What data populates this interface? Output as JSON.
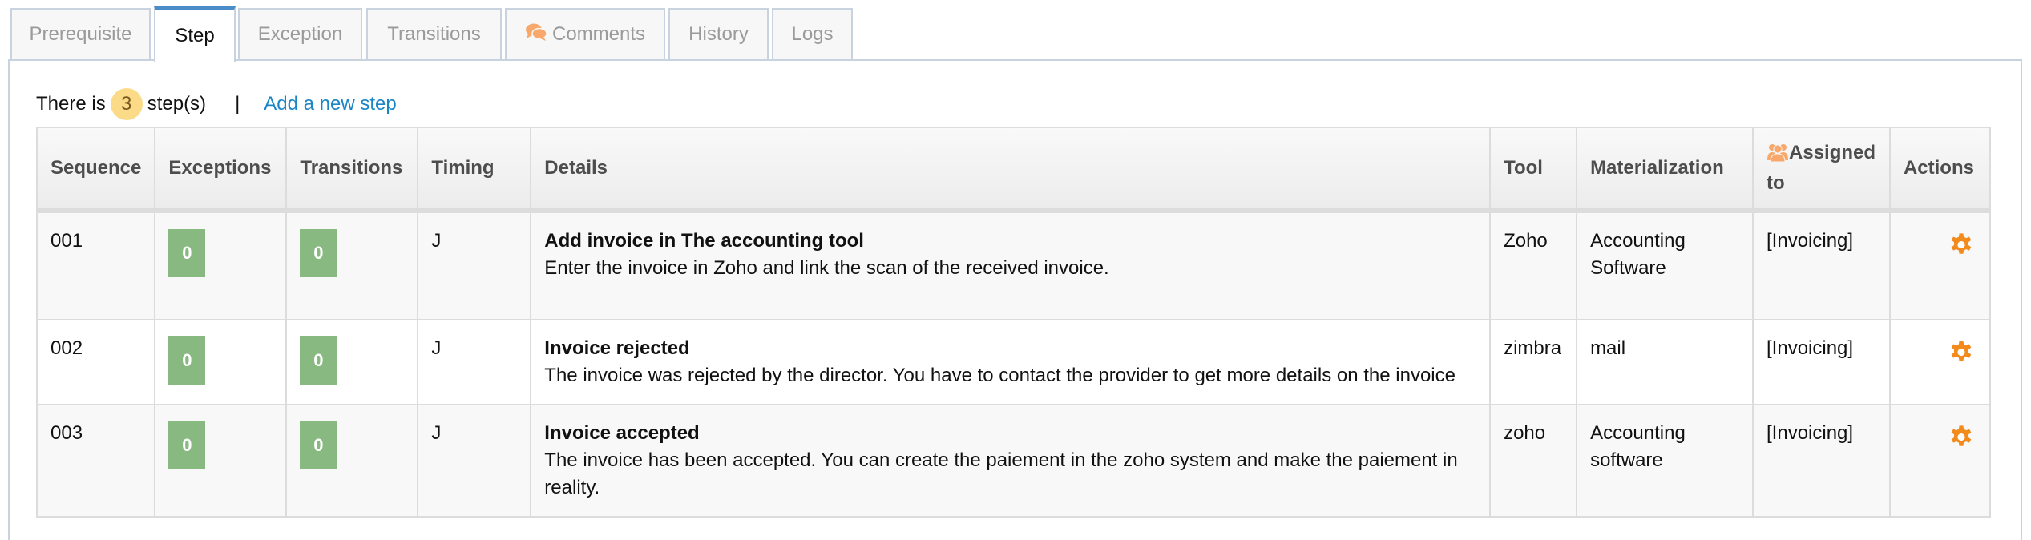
{
  "tabs": [
    {
      "label": "Prerequisite",
      "active": false
    },
    {
      "label": "Step",
      "active": true
    },
    {
      "label": "Exception",
      "active": false
    },
    {
      "label": "Transitions",
      "active": false
    },
    {
      "label": "Comments",
      "active": false,
      "icon": "comments-icon"
    },
    {
      "label": "History",
      "active": false
    },
    {
      "label": "Logs",
      "active": false
    }
  ],
  "summary": {
    "prefix": "There is",
    "count": "3",
    "suffix": "step(s)",
    "separator": "|",
    "add_link": "Add a new step"
  },
  "table": {
    "columns": [
      "Sequence",
      "Exceptions",
      "Transitions",
      "Timing",
      "Details",
      "Tool",
      "Materialization",
      "Assigned to",
      "Actions"
    ],
    "assigned_icon": "users-icon",
    "rows": [
      {
        "sequence": "001",
        "exceptions": "0",
        "transitions": "0",
        "timing": "J",
        "title": "Add invoice in The accounting tool",
        "description": "Enter the invoice in Zoho and link the scan of the received invoice.",
        "tool": "Zoho",
        "materialization": "Accounting Software",
        "assigned_to": "[Invoicing]",
        "action_icon": "gear-icon"
      },
      {
        "sequence": "002",
        "exceptions": "0",
        "transitions": "0",
        "timing": "J",
        "title": "Invoice rejected",
        "description": "The invoice was rejected by the director. You have to contact the provider to get more details on the invoice",
        "tool": "zimbra",
        "materialization": "mail",
        "assigned_to": "[Invoicing]",
        "action_icon": "gear-icon"
      },
      {
        "sequence": "003",
        "exceptions": "0",
        "transitions": "0",
        "timing": "J",
        "title": "Invoice accepted",
        "description": "The invoice has been accepted. You can create the paiement in the zoho system and make the paiement in reality.",
        "tool": "zoho",
        "materialization": "Accounting software",
        "assigned_to": "[Invoicing]",
        "action_icon": "gear-icon"
      }
    ]
  },
  "colors": {
    "accent_tab": "#4a8cc8",
    "link": "#1b86c6",
    "count_badge": "#fbdb88",
    "counter_green": "#87b980",
    "icon_orange": "#f7a86a",
    "gear_orange": "#f28a1c"
  }
}
